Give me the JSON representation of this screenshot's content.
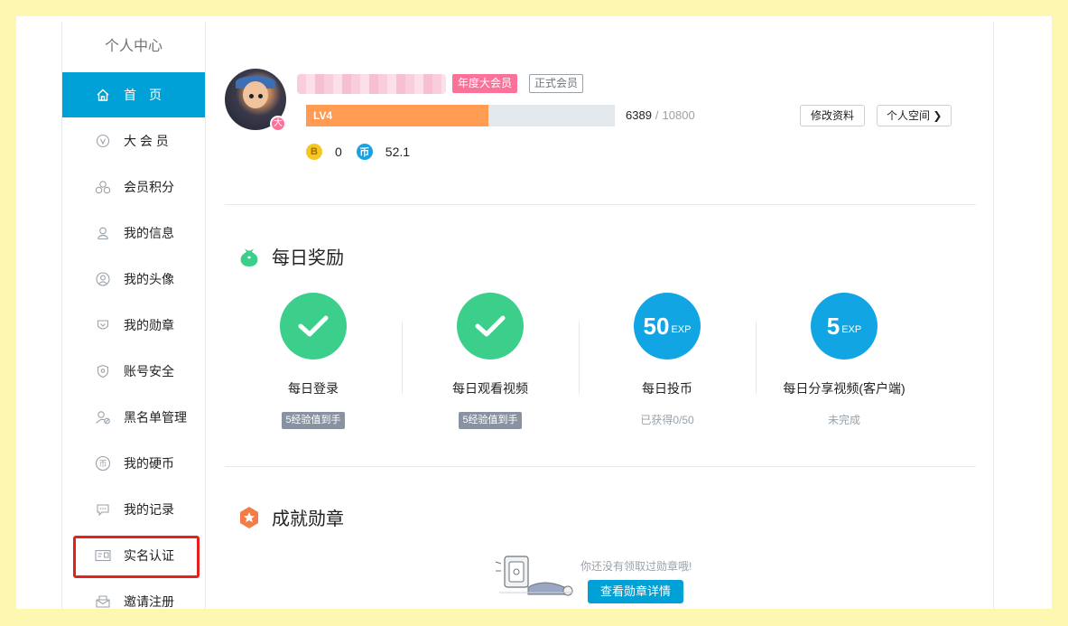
{
  "sidebar": {
    "title": "个人中心",
    "items": [
      {
        "label": "首页",
        "icon": "home-icon"
      },
      {
        "label": "大 会 员",
        "icon": "vip-icon"
      },
      {
        "label": "会员积分",
        "icon": "points-icon"
      },
      {
        "label": "我的信息",
        "icon": "user-info-icon"
      },
      {
        "label": "我的头像",
        "icon": "avatar-icon"
      },
      {
        "label": "我的勋章",
        "icon": "medal-icon"
      },
      {
        "label": "账号安全",
        "icon": "shield-icon"
      },
      {
        "label": "黑名单管理",
        "icon": "blacklist-icon"
      },
      {
        "label": "我的硬币",
        "icon": "coin-icon"
      },
      {
        "label": "我的记录",
        "icon": "record-icon"
      },
      {
        "label": "实名认证",
        "icon": "id-card-icon"
      },
      {
        "label": "邀请注册",
        "icon": "invite-icon"
      }
    ],
    "active_index": 0
  },
  "profile": {
    "vip_badge": "年度大会员",
    "member_badge": "正式会员",
    "vip_dot": "大",
    "level": "LV4",
    "exp_current": "6389",
    "exp_sep": "/",
    "exp_max": "10800",
    "exp_fraction": 0.59,
    "b_coin_symbol": "B",
    "b_coin": "0",
    "coin_symbol": "币",
    "coin": "52.1",
    "edit_button": "修改资料",
    "space_button": "个人空间 ❯"
  },
  "daily": {
    "title": "每日奖励",
    "tasks": [
      {
        "name": "每日登录",
        "state": "done",
        "badge": "5经验值到手"
      },
      {
        "name": "每日观看视频",
        "state": "done",
        "badge": "5经验值到手"
      },
      {
        "name": "每日投币",
        "state": "exp",
        "exp_value": "50",
        "exp_unit": "EXP",
        "status": "已获得0/50"
      },
      {
        "name": "每日分享视频(客户端)",
        "state": "exp",
        "exp_value": "5",
        "exp_unit": "EXP",
        "status": "未完成"
      }
    ]
  },
  "achievements": {
    "title": "成就勋章",
    "empty_text": "你还没有领取过勋章哦!",
    "detail_button": "查看勋章详情"
  },
  "colors": {
    "accent": "#00a1d6",
    "vip_pink": "#fb7299",
    "level_orange": "#ff9b52",
    "success_green": "#3ccf8b",
    "highlight_red": "#e5211d"
  }
}
